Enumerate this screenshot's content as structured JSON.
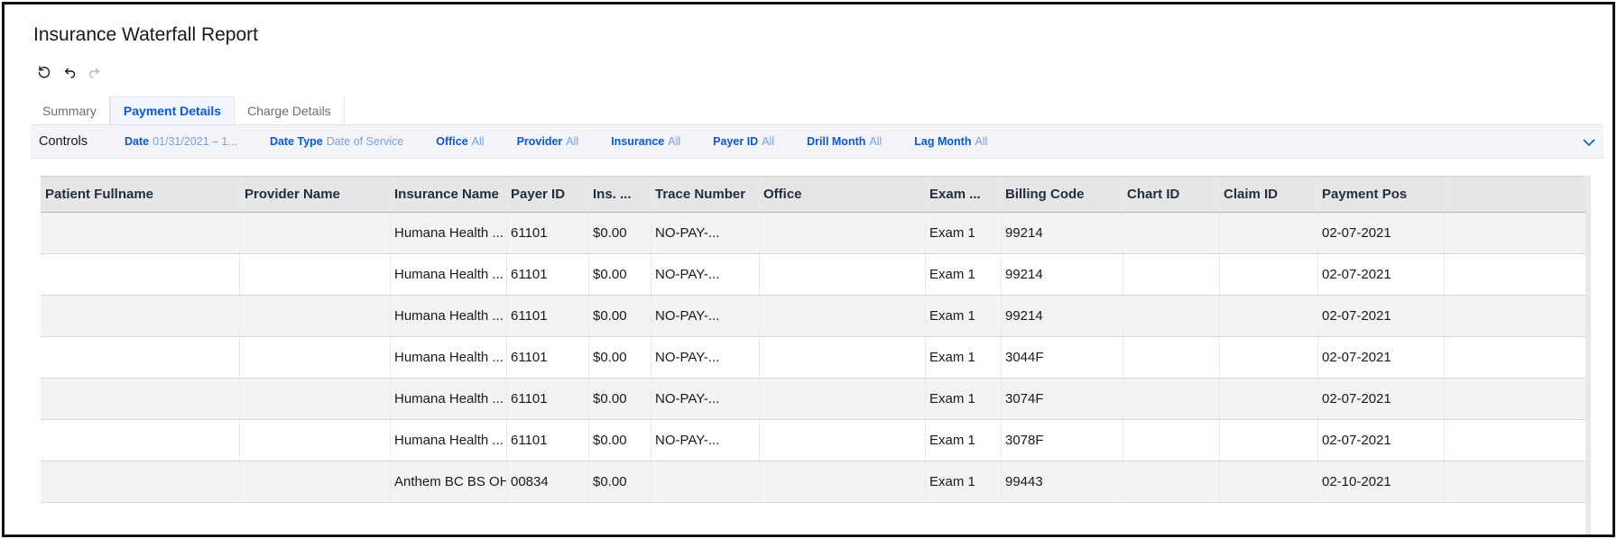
{
  "report": {
    "title": "Insurance Waterfall Report"
  },
  "toolbar": {
    "reset_icon": "reset-icon",
    "undo_icon": "undo-icon",
    "redo_icon": "redo-icon"
  },
  "tabs": [
    {
      "label": "Summary",
      "active": false
    },
    {
      "label": "Payment Details",
      "active": true
    },
    {
      "label": "Charge Details",
      "active": false
    }
  ],
  "controls": {
    "label": "Controls",
    "filters": [
      {
        "key": "Date",
        "value": "01/31/2021 – 1..."
      },
      {
        "key": "Date Type",
        "value": "Date of Service"
      },
      {
        "key": "Office",
        "value": "All"
      },
      {
        "key": "Provider",
        "value": "All"
      },
      {
        "key": "Insurance",
        "value": "All"
      },
      {
        "key": "Payer ID",
        "value": "All"
      },
      {
        "key": "Drill Month",
        "value": "All"
      },
      {
        "key": "Lag Month",
        "value": "All"
      }
    ]
  },
  "table": {
    "columns": [
      "Patient Fullname",
      "Provider Name",
      "Insurance Name",
      "Payer ID",
      "Ins. ...",
      "Trace Number",
      "Office",
      "Exam ...",
      "Billing Code",
      "Chart ID",
      "Claim ID",
      "Payment Pos"
    ],
    "rows": [
      [
        "",
        "",
        "Humana Health ...",
        "61101",
        "$0.00",
        "NO-PAY-...",
        "",
        "Exam 1",
        "99214",
        "",
        "",
        "02-07-2021"
      ],
      [
        "",
        "",
        "Humana Health ...",
        "61101",
        "$0.00",
        "NO-PAY-...",
        "",
        "Exam 1",
        "99214",
        "",
        "",
        "02-07-2021"
      ],
      [
        "",
        "",
        "Humana Health ...",
        "61101",
        "$0.00",
        "NO-PAY-...",
        "",
        "Exam 1",
        "99214",
        "",
        "",
        "02-07-2021"
      ],
      [
        "",
        "",
        "Humana Health ...",
        "61101",
        "$0.00",
        "NO-PAY-...",
        "",
        "Exam 1",
        "3044F",
        "",
        "",
        "02-07-2021"
      ],
      [
        "",
        "",
        "Humana Health ...",
        "61101",
        "$0.00",
        "NO-PAY-...",
        "",
        "Exam 1",
        "3074F",
        "",
        "",
        "02-07-2021"
      ],
      [
        "",
        "",
        "Humana Health ...",
        "61101",
        "$0.00",
        "NO-PAY-...",
        "",
        "Exam 1",
        "3078F",
        "",
        "",
        "02-07-2021"
      ],
      [
        "",
        "",
        "Anthem BC BS OH",
        "00834",
        "$0.00",
        "",
        "",
        "Exam 1",
        "99443",
        "",
        "",
        "02-10-2021"
      ]
    ]
  },
  "colors": {
    "accent": "#0b59d6",
    "filter_value": "#7a9fe0",
    "header_bg": "#e6e6e6",
    "row_alt_bg": "#f3f3f3"
  }
}
